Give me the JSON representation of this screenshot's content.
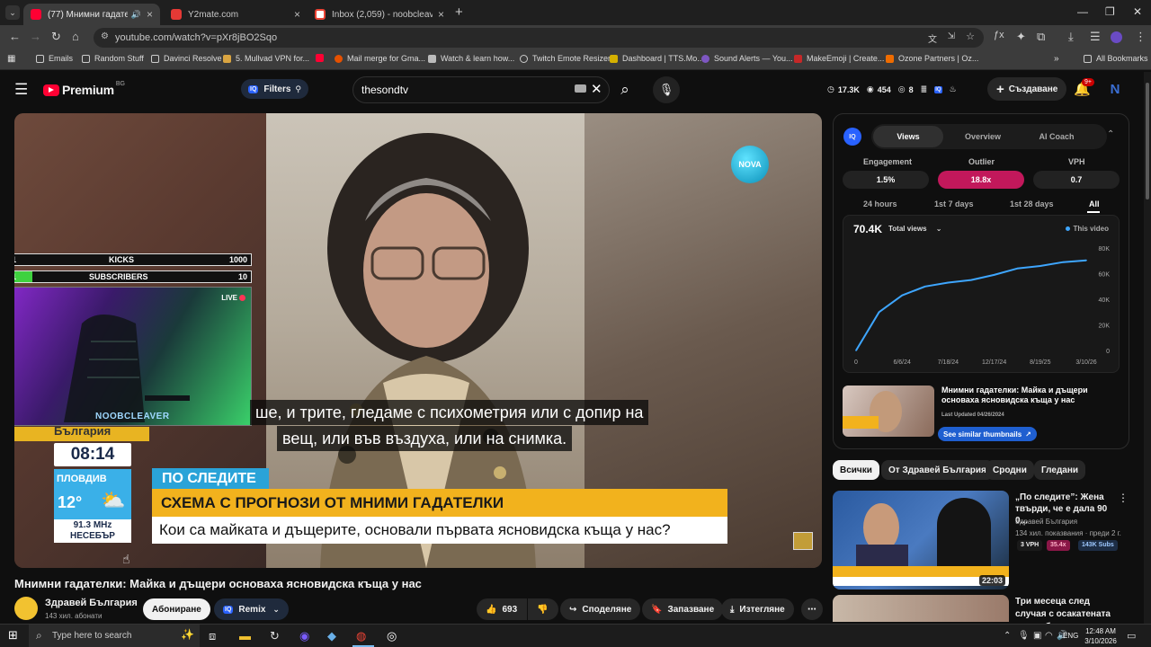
{
  "browser": {
    "tabs": [
      {
        "title": "(77) Мнимни гадателки: Ма",
        "active": true
      },
      {
        "title": "Y2mate.com",
        "active": false
      },
      {
        "title": "Inbox (2,059) - noobcleave@g",
        "active": false
      }
    ],
    "url": "youtube.com/watch?v=pXr8jBO2Sqo",
    "bookmarks": [
      "Emails",
      "Random Stuff",
      "Davinci Resolve",
      "5. Mullvad VPN for...",
      "Mail merge for Gma...",
      "Watch & learn how...",
      "Twitch Emote Resizer",
      "Dashboard | TTS.Mo...",
      "Sound Alerts — You...",
      "MakeEmoji | Create...",
      "Ozone Partners | Oz..."
    ],
    "all_bookmarks": "All Bookmarks"
  },
  "header": {
    "logo": "Premium",
    "region": "BG",
    "filters": "Filters",
    "search_value": "thesondtv",
    "stat_views": "17.3K",
    "stat_mid": "454",
    "stat_small": "8",
    "create_label": "Създаване",
    "notif_count": "9+",
    "avatar_letter": "N"
  },
  "overlay": {
    "kicks_label": "KICKS",
    "kicks_left": "1",
    "kicks_right": "1000",
    "subs_label": "SUBSCRIBERS",
    "subs_left": "1",
    "subs_right": "10",
    "live": "LIVE",
    "streamer": "NOOBCLEAVER"
  },
  "video": {
    "subtitle_line1": "ше, и трите, гледаме с психометрия или с допир на",
    "subtitle_line2": "вещ, или във въздуха, или на снимка.",
    "channel_logo": "NOVA",
    "clock": "08:14",
    "city": "ПЛОВДИВ",
    "temp": "12°",
    "radio_freq": "91.3 MHz",
    "radio_city": "НЕСЕБЪР",
    "channel_strip": "България",
    "lower_tag": "ПО СЛЕДИТЕ",
    "lower_title": "СХЕМА С ПРОГНОЗИ ОТ МНИМИ ГАДАТЕЛКИ",
    "lower_sub": "Кои са майката и дъщерите, основали първата ясновидска къща у нас?"
  },
  "info": {
    "title": "Мнимни гадателки: Майка и дъщери основаха ясновидска къща у нас",
    "channel": "Здравей България",
    "subs": "143 хил. абонати",
    "subscribe": "Абониране",
    "remix": "Remix",
    "likes": "693",
    "share": "Споделяне",
    "save": "Запазване",
    "download": "Изтегляне"
  },
  "vidiq": {
    "tabs": [
      "Views",
      "Overview",
      "AI Coach"
    ],
    "engagement_label": "Engagement",
    "engagement": "1.5%",
    "outlier_label": "Outlier",
    "outlier": "18.8x",
    "vph_label": "VPH",
    "vph": "0.7",
    "ranges": [
      "24 hours",
      "1st 7 days",
      "1st 28 days",
      "All"
    ],
    "total": "70.4K",
    "total_label": "Total views",
    "legend": "This video",
    "video_title": "Мнимни гадателки: Майка и дъщери основаха ясновидска къща у нас",
    "last_updated": "Last Updated 04/26/2024",
    "similar": "See similar thumbnails",
    "accent": "#3ea6ff",
    "outlier_color": "#c2185b"
  },
  "chart_data": {
    "type": "line",
    "series": [
      {
        "name": "This video",
        "values": [
          0,
          30000,
          43000,
          50000,
          53000,
          55000,
          59000,
          64000,
          66000,
          69000,
          70400
        ]
      }
    ],
    "x": [
      "0",
      "",
      "6/6/24",
      "",
      "7/18/24",
      "",
      "12/17/24",
      "",
      "8/19/25",
      "",
      "3/10/26"
    ],
    "x_ticks": [
      "0",
      "6/6/24",
      "7/18/24",
      "12/17/24",
      "8/19/25",
      "3/10/26"
    ],
    "y_ticks": [
      "80K",
      "60K",
      "40K",
      "20K",
      "0"
    ],
    "ylim": [
      0,
      80000
    ]
  },
  "chips": [
    "Всички",
    "От Здравей България",
    "Сродни",
    "Гледани"
  ],
  "recs": [
    {
      "title": "„По следите”: Жена твърди, че е дала 90 0...",
      "channel": "Здравей България",
      "meta": "134 хил. показвания · преди 2 г.",
      "vph": "3 VPH",
      "outlier": "35.4x",
      "subs": "143K Subs",
      "duration": "22:03"
    },
    {
      "title": "Три месеца след случая с осакатената при поб...",
      "channel": "",
      "meta": "",
      "vph": "",
      "outlier": "",
      "subs": "",
      "duration": ""
    }
  ],
  "taskbar": {
    "search": "Type here to search",
    "lang": "ENG",
    "time": "12:48 AM",
    "date": "3/10/2026"
  }
}
